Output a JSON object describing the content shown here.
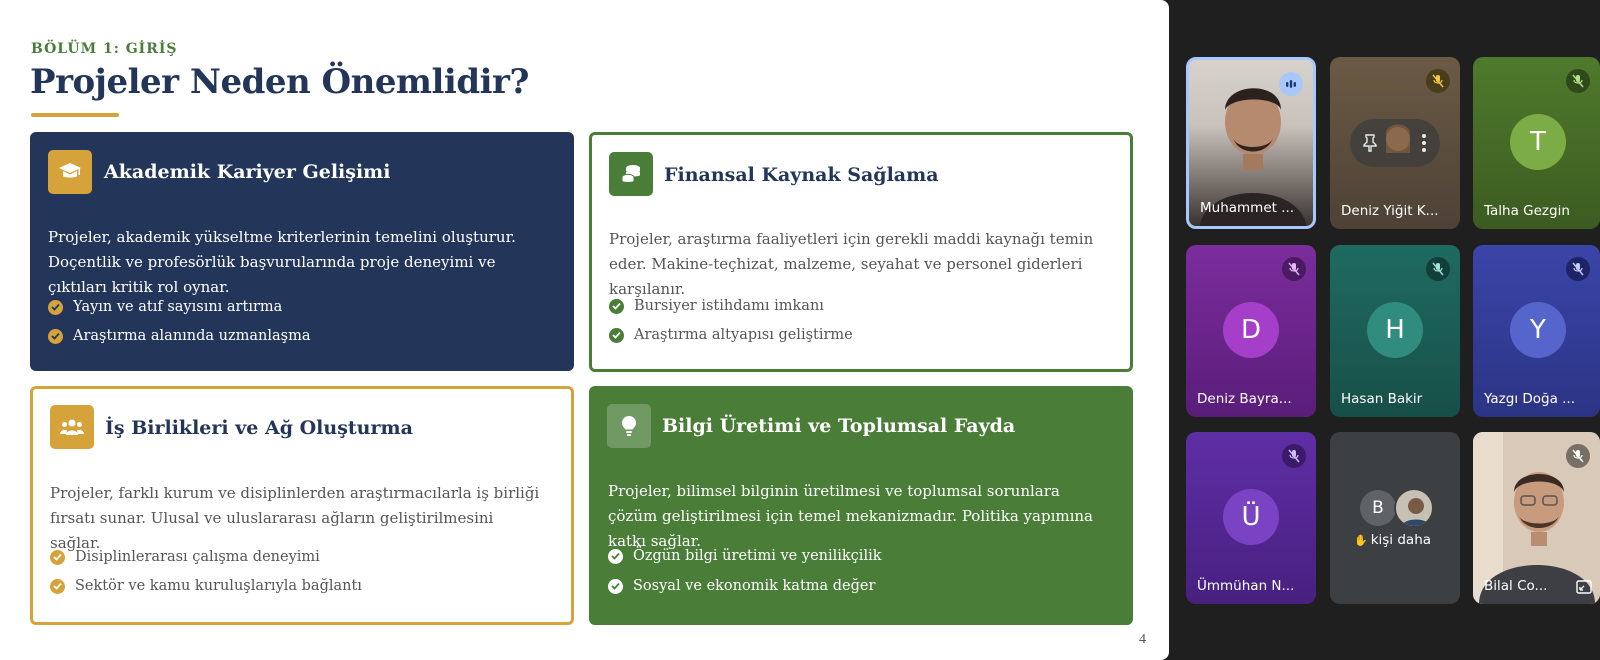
{
  "slide": {
    "section_label": "BÖLÜM 1: GİRİŞ",
    "title": "Projeler Neden Önemlidir?",
    "page_number": "4",
    "cards": [
      {
        "title": "Akademik Kariyer Gelişimi",
        "icon": "graduation-cap-icon",
        "body": "Projeler, akademik yükseltme kriterlerinin temelini oluşturur. Doçentlik ve profesörlük başvurularında proje deneyimi ve çıktıları kritik rol oynar.",
        "bullets": [
          "Yayın ve atıf sayısını artırma",
          "Araştırma alanında uzmanlaşma"
        ]
      },
      {
        "title": "Finansal Kaynak Sağlama",
        "icon": "coins-icon",
        "body": "Projeler, araştırma faaliyetleri için gerekli maddi kaynağı temin eder. Makine-teçhizat, malzeme, seyahat ve personel giderleri karşılanır.",
        "bullets": [
          "Bursiyer istihdamı imkanı",
          "Araştırma altyapısı geliştirme"
        ]
      },
      {
        "title": "İş Birlikleri ve Ağ Oluşturma",
        "icon": "users-icon",
        "body": "Projeler, farklı kurum ve disiplinlerden araştırmacılarla iş birliği fırsatı sunar. Ulusal ve uluslararası ağların geliştirilmesini sağlar.",
        "bullets": [
          "Disiplinlerarası çalışma deneyimi",
          "Sektör ve kamu kuruluşlarıyla bağlantı"
        ]
      },
      {
        "title": "Bilgi Üretimi ve Toplumsal Fayda",
        "icon": "lightbulb-icon",
        "body": "Projeler, bilimsel bilginin üretilmesi ve toplumsal sorunlara çözüm geliştirilmesi için temel mekanizmadır. Politika yapımına katkı sağlar.",
        "bullets": [
          "Özgün bilgi üretimi ve yenilikçilik",
          "Sosyal ve ekonomik katma değer"
        ]
      }
    ]
  },
  "participants": [
    {
      "name": "Muhammet ...",
      "type": "video",
      "speaking": true
    },
    {
      "name": "Deniz Yiğit K...",
      "type": "video",
      "muted": true
    },
    {
      "name": "Talha Gezgin",
      "initial": "T",
      "muted": true
    },
    {
      "name": "Deniz Bayra...",
      "initial": "D",
      "muted": true
    },
    {
      "name": "Hasan Bakir",
      "initial": "H",
      "muted": true
    },
    {
      "name": "Yazgı Doğa ...",
      "initial": "Y",
      "muted": true
    },
    {
      "name": "Ümmühan N...",
      "initial": "Ü",
      "muted": true
    },
    {
      "name": "kişi daha",
      "initial": "B",
      "type": "overflow"
    },
    {
      "name": "Bilal Co...",
      "type": "video",
      "muted": true
    }
  ],
  "colors": {
    "navy": "#233659",
    "green": "#4a7d38",
    "gold": "#d5a33a"
  }
}
